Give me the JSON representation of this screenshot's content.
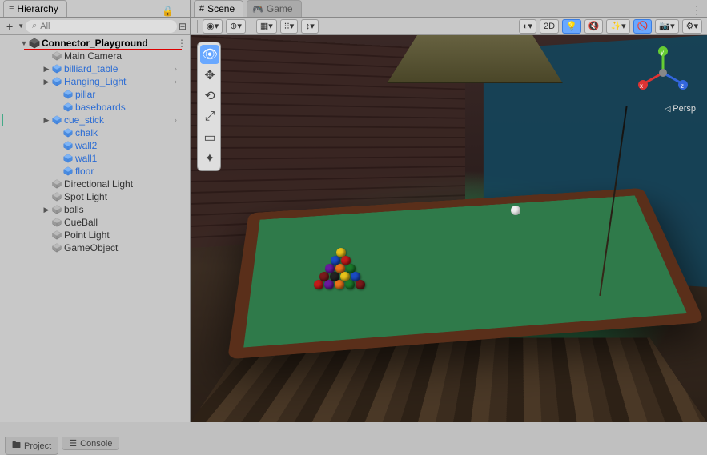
{
  "hierarchy": {
    "tab_label": "Hierarchy",
    "search_placeholder": "All",
    "scene_name": "Connector_Playground",
    "items": [
      {
        "label": "Main Camera",
        "indent": 2,
        "prefab": false,
        "expandable": false
      },
      {
        "label": "billiard_table",
        "indent": 2,
        "prefab": true,
        "expandable": true
      },
      {
        "label": "Hanging_Light",
        "indent": 2,
        "prefab": true,
        "expandable": true
      },
      {
        "label": "pillar",
        "indent": 3,
        "prefab": true,
        "expandable": false
      },
      {
        "label": "baseboards",
        "indent": 3,
        "prefab": true,
        "expandable": false
      },
      {
        "label": "cue_stick",
        "indent": 2,
        "prefab": true,
        "expandable": true,
        "modified": true
      },
      {
        "label": "chalk",
        "indent": 3,
        "prefab": true,
        "expandable": false
      },
      {
        "label": "wall2",
        "indent": 3,
        "prefab": true,
        "expandable": false
      },
      {
        "label": "wall1",
        "indent": 3,
        "prefab": true,
        "expandable": false
      },
      {
        "label": "floor",
        "indent": 3,
        "prefab": true,
        "expandable": false
      },
      {
        "label": "Directional Light",
        "indent": 2,
        "prefab": false,
        "expandable": false
      },
      {
        "label": "Spot Light",
        "indent": 2,
        "prefab": false,
        "expandable": false
      },
      {
        "label": "balls",
        "indent": 2,
        "prefab": false,
        "expandable": true
      },
      {
        "label": "CueBall",
        "indent": 2,
        "prefab": false,
        "expandable": false
      },
      {
        "label": "Point Light",
        "indent": 2,
        "prefab": false,
        "expandable": false
      },
      {
        "label": "GameObject",
        "indent": 2,
        "prefab": false,
        "expandable": false
      }
    ]
  },
  "scene": {
    "tab_scene": "Scene",
    "tab_game": "Game",
    "toolbar": {
      "btn_2d": "2D"
    },
    "camera_mode": "Persp",
    "gizmo_axes": {
      "x": "x",
      "y": "y",
      "z": "z"
    }
  },
  "bottom": {
    "tab_project": "Project",
    "tab_console": "Console"
  },
  "icons": {
    "search": "⌕",
    "collapse": "⊟",
    "dots": "⋮",
    "lock": "🔓"
  }
}
